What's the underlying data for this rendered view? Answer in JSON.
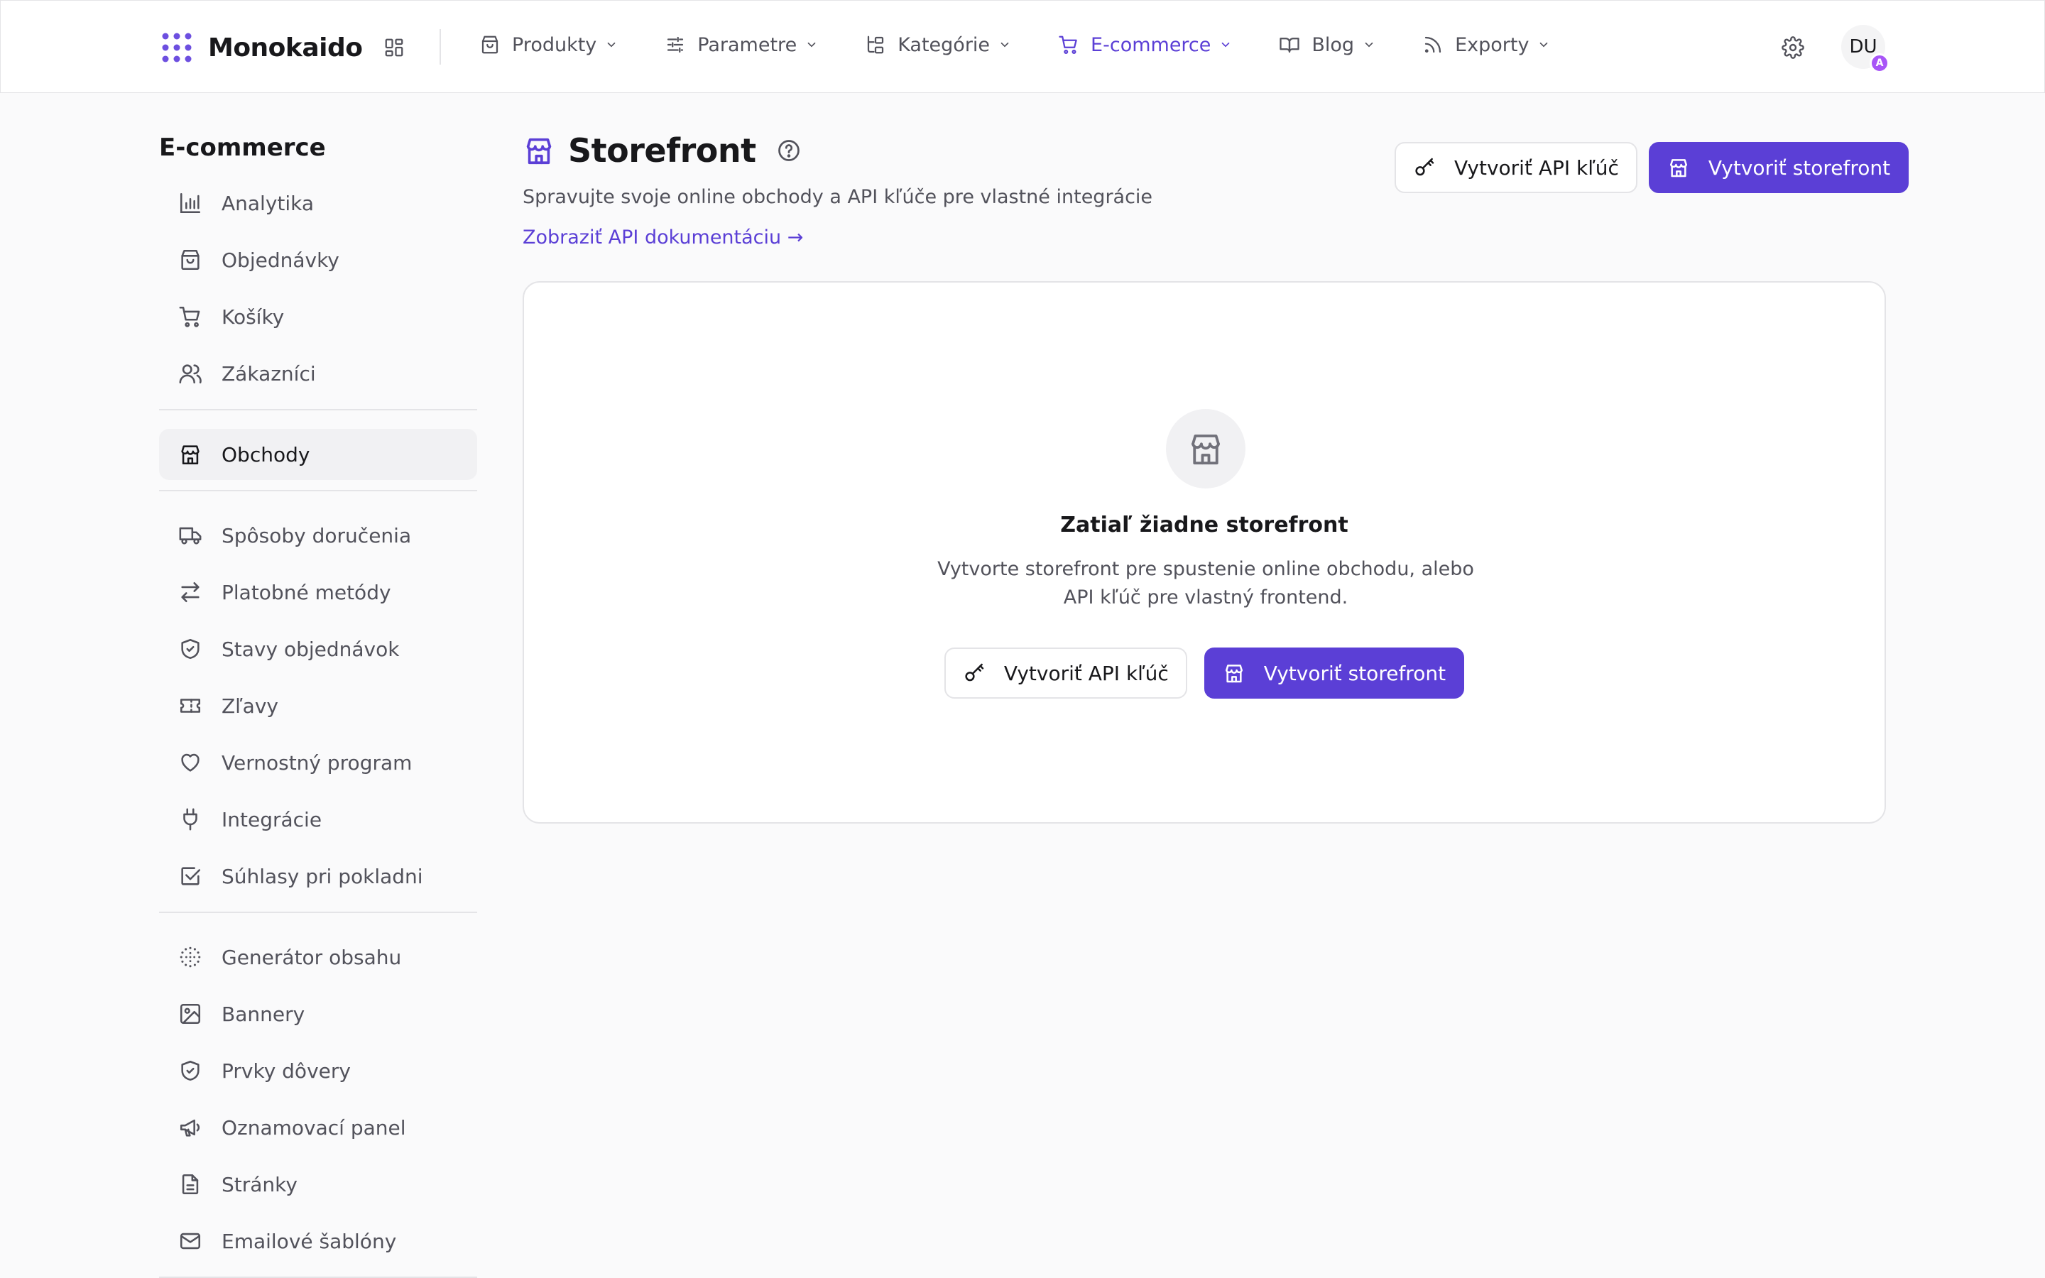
{
  "brand": {
    "name": "Monokaido"
  },
  "nav": [
    {
      "label": "Produkty",
      "icon": "shopping-bag-icon"
    },
    {
      "label": "Parametre",
      "icon": "sliders-icon"
    },
    {
      "label": "Kategórie",
      "icon": "tree-icon"
    },
    {
      "label": "E-commerce",
      "icon": "cart-icon",
      "active": true
    },
    {
      "label": "Blog",
      "icon": "book-icon"
    },
    {
      "label": "Exporty",
      "icon": "rss-icon"
    }
  ],
  "user": {
    "initials": "DU",
    "badge": "A"
  },
  "sidebar": {
    "title": "E-commerce",
    "items": [
      {
        "label": "Analytika",
        "icon": "bar-chart-icon"
      },
      {
        "label": "Objednávky",
        "icon": "shopping-bag-icon"
      },
      {
        "label": "Košíky",
        "icon": "cart-icon"
      },
      {
        "label": "Zákazníci",
        "icon": "users-icon"
      },
      {
        "label": "Obchody",
        "icon": "store-icon",
        "active": true
      },
      {
        "label": "Spôsoby doručenia",
        "icon": "truck-icon"
      },
      {
        "label": "Platobné metódy",
        "icon": "arrows-icon"
      },
      {
        "label": "Stavy objednávok",
        "icon": "shield-check-icon"
      },
      {
        "label": "Zľavy",
        "icon": "ticket-icon"
      },
      {
        "label": "Vernostný program",
        "icon": "heart-icon"
      },
      {
        "label": "Integrácie",
        "icon": "plug-icon"
      },
      {
        "label": "Súhlasy pri pokladni",
        "icon": "checkbox-icon"
      },
      {
        "label": "Generátor obsahu",
        "icon": "dots-circle-icon"
      },
      {
        "label": "Bannery",
        "icon": "image-icon"
      },
      {
        "label": "Prvky dôvery",
        "icon": "shield-icon"
      },
      {
        "label": "Oznamovací panel",
        "icon": "megaphone-icon"
      },
      {
        "label": "Stránky",
        "icon": "file-icon"
      },
      {
        "label": "Emailové šablóny",
        "icon": "mail-icon"
      }
    ]
  },
  "page": {
    "title": "Storefront",
    "subtitle": "Spravujte svoje online obchody a API kľúče pre vlastné integrácie",
    "doc_link": "Zobraziť API dokumentáciu →",
    "create_key_label": "Vytvoriť API kľúč",
    "create_storefront_label": "Vytvoriť storefront"
  },
  "empty_state": {
    "title": "Zatiaľ žiadne storefront",
    "description": "Vytvorte storefront pre spustenie online obchodu, alebo API kľúč pre vlastný frontend.",
    "create_key_label": "Vytvoriť API kľúč",
    "create_storefront_label": "Vytvoriť storefront"
  },
  "colors": {
    "accent": "#5b3fd6",
    "badge": "#a855f7",
    "text": "#18181b",
    "muted": "#52525b",
    "border": "#e4e4e7",
    "background": "#fafafb"
  }
}
